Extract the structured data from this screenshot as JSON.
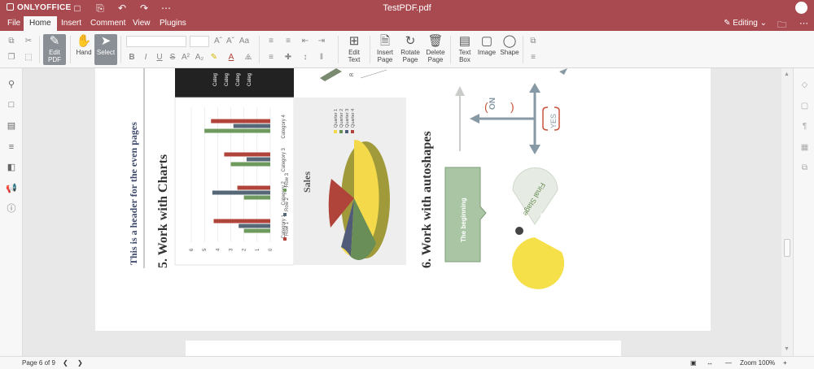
{
  "app": {
    "logo": "ONLYOFFICE",
    "document_title": "TestPDF.pdf",
    "user_initial": "",
    "colors": {
      "brand": "#a84a4f",
      "toolbar": "#f7f7f7",
      "accent_active": "#8a8f95"
    }
  },
  "menu": {
    "tabs": [
      {
        "label": "File"
      },
      {
        "label": "Home"
      },
      {
        "label": "Insert"
      },
      {
        "label": "Comment"
      },
      {
        "label": "View"
      },
      {
        "label": "Plugins"
      }
    ],
    "active_tab": "Home",
    "mode_label": "Editing"
  },
  "toolbar": {
    "edit_pdf": "Edit PDF",
    "hand": "Hand",
    "select": "Select",
    "edit_text": "Edit Text",
    "insert_page": "Insert Page",
    "rotate_page": "Rotate Page",
    "delete_page": "Delete Page",
    "text_box": "Text Box",
    "image": "Image",
    "shape": "Shape",
    "font_buttons": [
      "B",
      "I",
      "U",
      "S",
      "A²",
      "A₂"
    ]
  },
  "document": {
    "header_text": "This is a header for the even pages",
    "heading5": "5.   Work with Charts",
    "heading6": "6.   Work with autoshapes",
    "pie_title": "Sales",
    "pie_legend": [
      "Quarter 1",
      "Quarter 2",
      "Quarter 3",
      "Quarter 4"
    ],
    "bar_categories": [
      "Category 1",
      "Category 2",
      "Category 3",
      "Category 4"
    ],
    "bar_legend": [
      "Row 1",
      "Row 2",
      "Row 3"
    ],
    "bar_axis_ticks": [
      "0",
      "1",
      "2",
      "3",
      "4",
      "5",
      "6"
    ],
    "dark_table_labels": [
      "Categ",
      "Categ",
      "Categ",
      "Categ"
    ],
    "dark_table_fragment": "R",
    "shape_yes": "YES",
    "shape_no": "NO",
    "shape_beginning": "The beginning",
    "shape_final": "Final Stage",
    "colors": {
      "row1": "#b0433a",
      "row2": "#566877",
      "row3": "#6e9a5e",
      "q1": "#f4d94a",
      "q2": "#6a8e57",
      "q3": "#4f5b78",
      "q4": "#b0433a",
      "arrow": "#8799a4",
      "bracket": "#c8553d",
      "green_box": "#a9c5a4",
      "pacman": "#f5e04a"
    }
  },
  "chart_data": {
    "type": "bar",
    "categories": [
      "Category 1",
      "Category 2",
      "Category 3",
      "Category 4"
    ],
    "series": [
      {
        "name": "Row 1",
        "values": [
          4.3,
          2.5,
          3.5,
          4.5
        ]
      },
      {
        "name": "Row 2",
        "values": [
          2.4,
          4.4,
          1.8,
          2.8
        ]
      },
      {
        "name": "Row 3",
        "values": [
          2,
          2,
          3,
          5
        ]
      }
    ],
    "xlim": [
      0,
      6
    ]
  },
  "pie_chart_data": {
    "type": "pie",
    "title": "Sales",
    "categories": [
      "Quarter 1",
      "Quarter 2",
      "Quarter 3",
      "Quarter 4"
    ],
    "values": [
      57,
      22,
      11,
      10
    ]
  },
  "status": {
    "page_info": "Page 6 of 9",
    "zoom": "Zoom 100%"
  }
}
